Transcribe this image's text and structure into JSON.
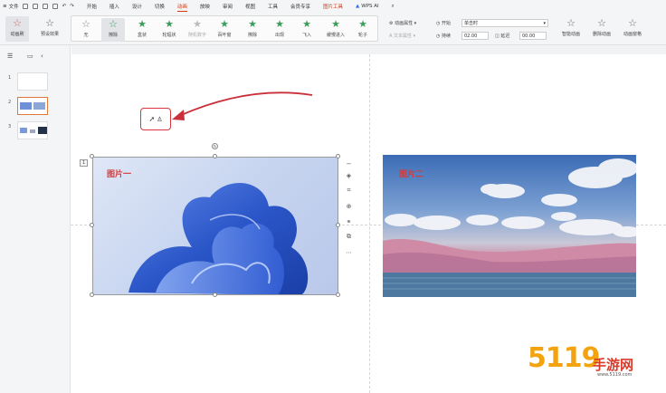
{
  "menubar": {
    "file": "文件",
    "tabs": [
      "开始",
      "插入",
      "设计",
      "切换",
      "动画",
      "放映",
      "审阅",
      "视图",
      "工具",
      "会员专享"
    ],
    "active_tab": "动画",
    "tool_tab": "图片工具",
    "ai": "WPS AI"
  },
  "ribbon": {
    "preview": "动画刷",
    "preset": "预设效果",
    "effects": [
      "无",
      "擦除",
      "盒状",
      "轮辐状",
      "随机数字",
      "百叶窗",
      "擦除",
      "出现",
      "飞入",
      "缓慢进入",
      "轮子"
    ],
    "anim_props": "动画属性",
    "text_props": "文本属性",
    "start_label": "开始",
    "start_value": "单击时",
    "duration_label": "持续",
    "duration_value": "02.00",
    "delay_label": "延迟",
    "delay_value": "00.00",
    "smart": "智能动画",
    "delete_anim": "删除动画",
    "anim_pane": "动画窗格"
  },
  "thumbnails": [
    "1",
    "2",
    "3"
  ],
  "slide": {
    "image1_caption": "图片一",
    "image2_caption": "图片二",
    "badge": "1"
  },
  "watermark": {
    "digits": "5119",
    "brand": "手游网",
    "url": "www.5119.com"
  }
}
